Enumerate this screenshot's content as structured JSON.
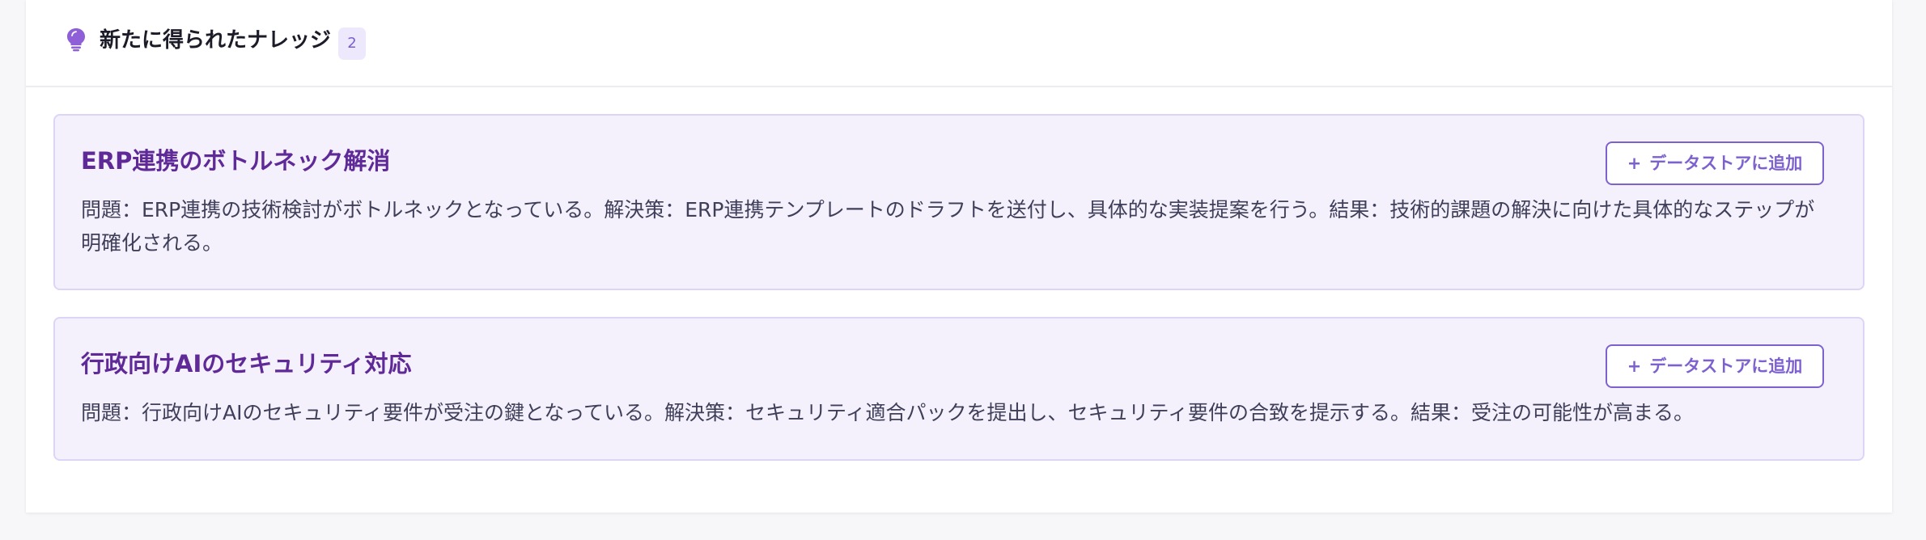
{
  "header": {
    "icon": "lightbulb-icon",
    "title": "新たに得られたナレッジ",
    "count": "2",
    "accent": "#7a5fd0"
  },
  "knowledge": [
    {
      "title": "ERP連携のボトルネック解消",
      "description": "問題：ERP連携の技術検討がボトルネックとなっている。解決策：ERP連携テンプレートのドラフトを送付し、具体的な実装提案を行う。結果：技術的課題の解決に向けた具体的なステップが明確化される。",
      "button_icon": "+",
      "button_label": "データストアに追加"
    },
    {
      "title": "行政向けAIのセキュリティ対応",
      "description": "問題：行政向けAIのセキュリティ要件が受注の鍵となっている。解決策：セキュリティ適合パックを提出し、セキュリティ要件の合致を提示する。結果：受注の可能性が高まる。",
      "button_icon": "+",
      "button_label": "データストアに追加"
    }
  ]
}
